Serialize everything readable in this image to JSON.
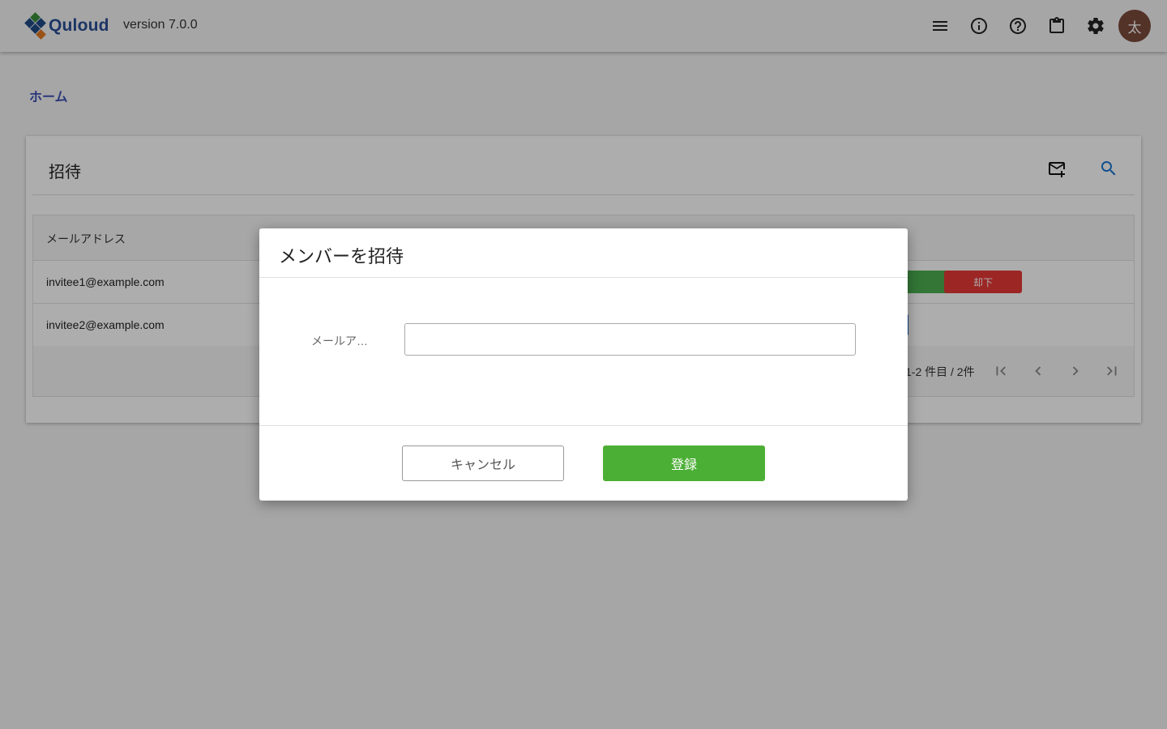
{
  "header": {
    "logo_text": "Quloud",
    "version": "version 7.0.0",
    "icons": [
      "menu-icon",
      "info-icon",
      "help-icon",
      "clipboard-icon",
      "settings-icon"
    ],
    "avatar_initial": "太"
  },
  "breadcrumb": {
    "home": "ホーム"
  },
  "card": {
    "title": "招待",
    "actions": [
      "mail-add-icon",
      "search-icon"
    ],
    "table": {
      "columns": [
        "メールアドレス"
      ],
      "rows": [
        {
          "email": "invitee1@example.com",
          "reject_label": "却下"
        },
        {
          "email": "invitee2@example.com"
        }
      ],
      "pagination_text": "1-2 件目 / 2件"
    }
  },
  "dialog": {
    "title": "メンバーを招待",
    "field_label": "メールア…",
    "field_value": "",
    "cancel_label": "キャンセル",
    "submit_label": "登録"
  },
  "colors": {
    "brand_blue": "#2a4f95",
    "link": "#3f51b5",
    "submit_green": "#4caf35",
    "approve_green": "#4caf50",
    "reject_red": "#e53935",
    "avatar_bg": "#7b4a3a"
  }
}
